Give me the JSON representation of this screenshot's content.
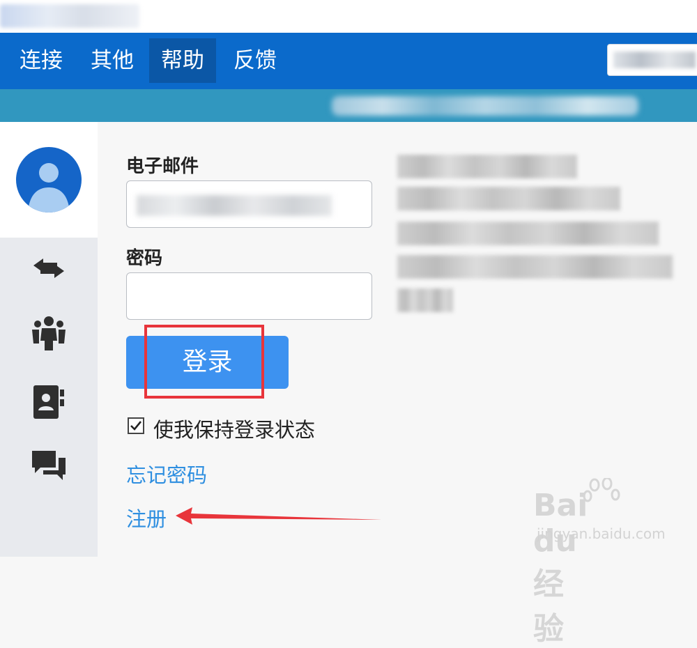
{
  "menu": {
    "items": [
      {
        "label": "连接"
      },
      {
        "label": "其他"
      },
      {
        "label": "帮助"
      },
      {
        "label": "反馈"
      }
    ],
    "active_index": 2
  },
  "sidebar": {
    "icons": [
      "transfer-arrows-icon",
      "group-icon",
      "contacts-icon",
      "chat-icon"
    ]
  },
  "form": {
    "email_label": "电子邮件",
    "password_label": "密码",
    "login_button": "登录",
    "keep_signed_in": "使我保持登录状态",
    "keep_signed_in_checked": true,
    "forgot_password": "忘记密码",
    "register": "注册"
  },
  "watermark": {
    "text": "Bai du 经验",
    "sub": "jingyan.baidu.com"
  },
  "colors": {
    "menubar": "#0b6acb",
    "infobar": "#3197bf",
    "button": "#3d92f0",
    "link": "#2f8fe0",
    "highlight": "#e8353b"
  }
}
